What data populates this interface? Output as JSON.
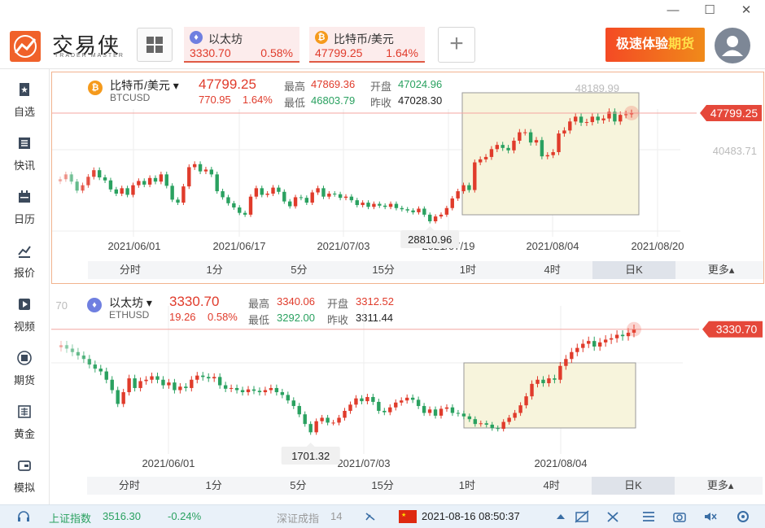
{
  "window": {
    "minimize": "—",
    "maximize": "☐",
    "close": "✕"
  },
  "brand": {
    "name": "交易侠",
    "sub": "TRADER MASTER"
  },
  "tabs": [
    {
      "name": "以太坊",
      "price": "3330.70",
      "pct": "0.58%",
      "coin_color": "#6f7fe0",
      "coin_glyph": "♦"
    },
    {
      "name": "比特币/美元",
      "price": "47799.25",
      "pct": "1.64%",
      "coin_color": "#f59a1c",
      "coin_glyph": "₿"
    }
  ],
  "add_label": "+",
  "promo": {
    "text1": "极速体验",
    "text2": "期货"
  },
  "sidebar": [
    {
      "label": "自选",
      "icon": "favorites-icon"
    },
    {
      "label": "快讯",
      "icon": "news-icon"
    },
    {
      "label": "日历",
      "icon": "calendar-icon"
    },
    {
      "label": "报价",
      "icon": "quote-chart-icon"
    },
    {
      "label": "视频",
      "icon": "video-icon"
    },
    {
      "label": "期货",
      "icon": "futures-icon"
    },
    {
      "label": "黄金",
      "icon": "gold-icon"
    },
    {
      "label": "模拟",
      "icon": "simulation-icon"
    }
  ],
  "timeframes": [
    "分时",
    "1分",
    "5分",
    "15分",
    "1时",
    "4时",
    "日K",
    "更多▴"
  ],
  "selected_timeframe": "日K",
  "colors": {
    "up": "#e03b2b",
    "down": "#2aa160",
    "accent": "#f0612a"
  },
  "btc": {
    "name": "比特币/美元",
    "code": "BTCUSD",
    "price": "47799.25",
    "change": "770.95",
    "pct": "1.64%",
    "high_label": "最高",
    "high": "47869.36",
    "low_label": "最低",
    "low": "46803.79",
    "open_label": "开盘",
    "open": "47024.96",
    "prev_label": "昨收",
    "prev": "47028.30"
  },
  "eth": {
    "name": "以太坊",
    "code": "ETHUSD",
    "price": "3330.70",
    "change": "19.26",
    "pct": "0.58%",
    "high_label": "最高",
    "high": "3340.06",
    "low_label": "最低",
    "low": "3292.00",
    "open_label": "开盘",
    "open": "3312.52",
    "prev_label": "昨收",
    "prev": "3311.44"
  },
  "chart_data": [
    {
      "type": "candlestick",
      "series_label": "BTCUSD",
      "x_ticks": [
        "2021/06/01",
        "2021/06/17",
        "2021/07/03",
        "2021/07/19",
        "2021/08/04",
        "2021/08/20"
      ],
      "y_range": [
        27500,
        50500
      ],
      "y_labels": [
        "48189.99",
        "40483.71"
      ],
      "current_price": "47799.25",
      "min_marker": "28810.96",
      "closes": [
        36800,
        37600,
        36400,
        34900,
        35800,
        37200,
        38300,
        37100,
        36600,
        35100,
        34400,
        35300,
        34200,
        35800,
        36500,
        35900,
        37000,
        36400,
        37600,
        35700,
        33400,
        32900,
        35600,
        38800,
        39300,
        38100,
        38400,
        37600,
        34800,
        33800,
        32800,
        32100,
        31200,
        30900,
        33900,
        35300,
        34200,
        34400,
        35400,
        34700,
        33100,
        32300,
        33800,
        33700,
        32900,
        34600,
        35300,
        33900,
        34400,
        34300,
        33700,
        33900,
        33300,
        32500,
        32900,
        32200,
        32700,
        32400,
        32200,
        32700,
        32000,
        31800,
        31600,
        31300,
        31900,
        30900,
        29800,
        30600,
        30900,
        32000,
        33600,
        34800,
        35800,
        35000,
        39600,
        40100,
        40500,
        41800,
        42500,
        42000,
        41600,
        43200,
        44600,
        44600,
        42900,
        43300,
        40600,
        40800,
        41300,
        44400,
        44900,
        46400,
        47200,
        46200,
        46300,
        47200,
        46600,
        46900,
        48000,
        46400,
        47500,
        47600,
        47799
      ]
    },
    {
      "type": "candlestick",
      "series_label": "ETHUSD",
      "x_ticks": [
        "2021/06/01",
        "2021/07/03",
        "2021/08/04"
      ],
      "y_range": [
        1550,
        3550
      ],
      "y_labels": [
        "70"
      ],
      "current_price": "3330.70",
      "min_marker": "1701.32",
      "closes": [
        3100,
        3050,
        3000,
        2950,
        2900,
        2820,
        2760,
        2720,
        2600,
        2450,
        2250,
        2420,
        2620,
        2480,
        2580,
        2600,
        2650,
        2600,
        2520,
        2560,
        2450,
        2500,
        2480,
        2600,
        2660,
        2640,
        2620,
        2640,
        2520,
        2470,
        2480,
        2450,
        2420,
        2460,
        2440,
        2420,
        2450,
        2480,
        2420,
        2380,
        2300,
        2220,
        2100,
        1960,
        1840,
        2000,
        2050,
        1980,
        1980,
        2050,
        2150,
        2240,
        2330,
        2290,
        2350,
        2280,
        2150,
        2130,
        2200,
        2270,
        2300,
        2340,
        2310,
        2220,
        2120,
        2170,
        2080,
        2180,
        2200,
        2120,
        2110,
        2070,
        2030,
        1960,
        1970,
        1950,
        1900,
        1890,
        1990,
        2050,
        2120,
        2230,
        2360,
        2540,
        2600,
        2550,
        2620,
        2600,
        2800,
        2900,
        3000,
        3060,
        3120,
        3160,
        3080,
        3140,
        3180,
        3200,
        3250,
        3230,
        3280,
        3330
      ]
    }
  ],
  "status": {
    "index_name": "上证指数",
    "index_value": "3516.30",
    "index_pct": "-0.24%",
    "sz_name": "深证成指",
    "sz_value": "14",
    "datetime": "2021-08-16 08:50:37"
  }
}
